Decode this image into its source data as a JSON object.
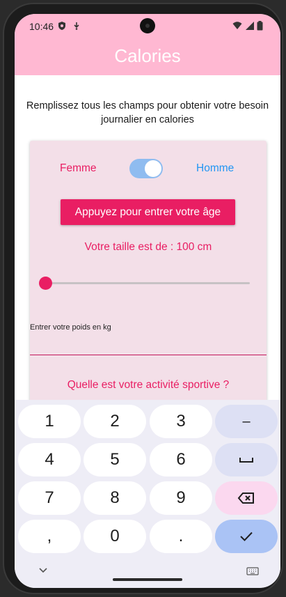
{
  "status_bar": {
    "time": "10:46"
  },
  "app_bar": {
    "title": "Calories"
  },
  "intro_text": "Remplissez tous les champs pour obtenir votre besoin journalier en calories",
  "form": {
    "gender": {
      "left_label": "Femme",
      "right_label": "Homme",
      "switch_on": true
    },
    "age_button": "Appuyez pour entrer votre âge",
    "height_text": "Votre taille est de : 100 cm",
    "height_slider_fraction": 0.0,
    "weight_label": "Entrer votre poids en kg",
    "weight_value": "",
    "activity_question": "Quelle est votre activité sportive ?"
  },
  "keyboard": {
    "keys": [
      "1",
      "2",
      "3",
      "–",
      "4",
      "5",
      "6",
      "␣",
      "7",
      "8",
      "9",
      "⌫",
      ",",
      "0",
      ".",
      "✓"
    ]
  },
  "colors": {
    "accent": "#e91e63",
    "male": "#2196f3",
    "app_bar": "#ffb8d2",
    "card": "#f3dfe8"
  }
}
